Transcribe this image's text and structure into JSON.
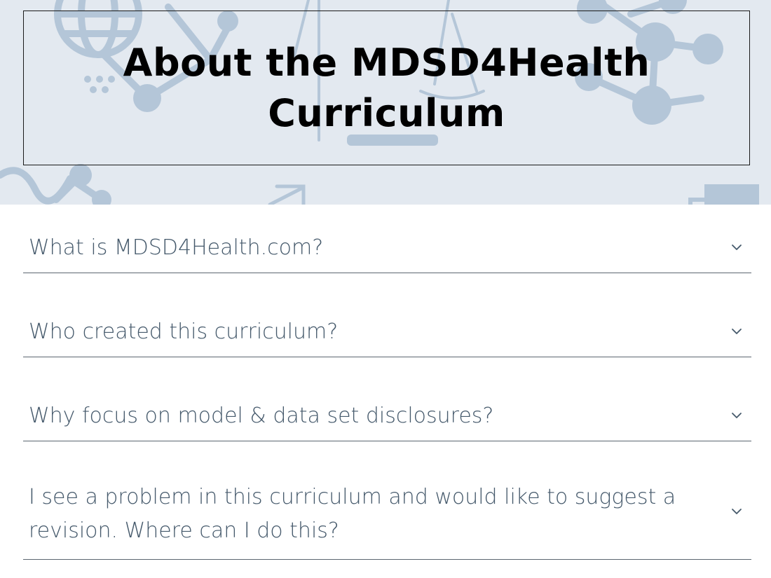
{
  "header": {
    "title": "About the MDSD4Health Curriculum",
    "background_color": "#e3e9f0",
    "decoration_color": "#b4c6d8",
    "decoration_icons": [
      "globe-icon",
      "molecule-network-icon",
      "scale-of-justice-icon",
      "trend-arrow-icon",
      "bar-chart-icon"
    ]
  },
  "faq": {
    "items": [
      {
        "question": "What is MDSD4Health.com?",
        "icon": "chevron-down-icon"
      },
      {
        "question": "Who created this curriculum?",
        "icon": "chevron-down-icon"
      },
      {
        "question": "Why focus on model & data set disclosures?",
        "icon": "chevron-down-icon"
      },
      {
        "question": "I see a problem in this curriculum and would like to suggest a revision. Where can I do this?",
        "icon": "chevron-down-icon"
      }
    ],
    "text_color": "#45596b",
    "divider_color": "#5b6670"
  }
}
